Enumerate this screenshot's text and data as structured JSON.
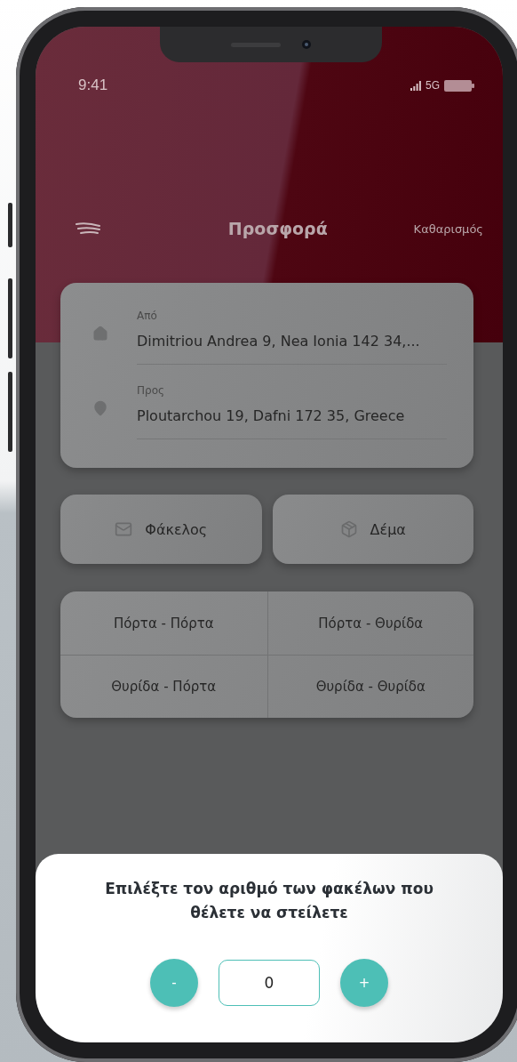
{
  "status_bar": {
    "time": "9:41",
    "network": "5G"
  },
  "header": {
    "title": "Προσφορά",
    "action": "Καθαρισμός"
  },
  "route": [
    {
      "kind": "home",
      "label": "Από",
      "address": "Dimitriou Andrea 9, Nea Ionia 142 34,..."
    },
    {
      "kind": "pin",
      "label": "Προς",
      "address": "Ploutarchou 19, Dafni 172 35, Greece"
    }
  ],
  "package_types": [
    {
      "kind": "envelope",
      "label": "Φάκελος"
    },
    {
      "kind": "parcel",
      "label": "Δέμα"
    }
  ],
  "delivery_options": [
    "Πόρτα - Πόρτα",
    "Πόρτα - Θυρίδα",
    "Θυρίδα - Πόρτα",
    "Θυρίδα - Θυρίδα"
  ],
  "bottom_sheet": {
    "title": "Επιλέξτε τον αριθμό των φακέλων που θέλετε να στείλετε",
    "decrement": "-",
    "quantity": "0",
    "increment": "+"
  }
}
